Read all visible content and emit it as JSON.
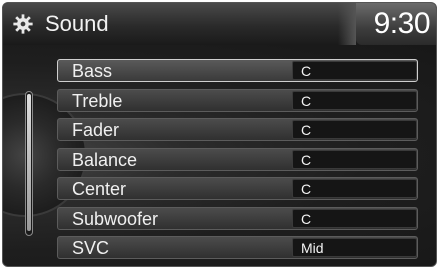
{
  "header": {
    "title": "Sound",
    "clock": "9:30",
    "icon": "gear-icon"
  },
  "items": [
    {
      "label": "Bass",
      "value": "C",
      "selected": true
    },
    {
      "label": "Treble",
      "value": "C"
    },
    {
      "label": "Fader",
      "value": "C"
    },
    {
      "label": "Balance",
      "value": "C"
    },
    {
      "label": "Center",
      "value": "C"
    },
    {
      "label": "Subwoofer",
      "value": "C"
    },
    {
      "label": "SVC",
      "value": "Mid"
    }
  ]
}
